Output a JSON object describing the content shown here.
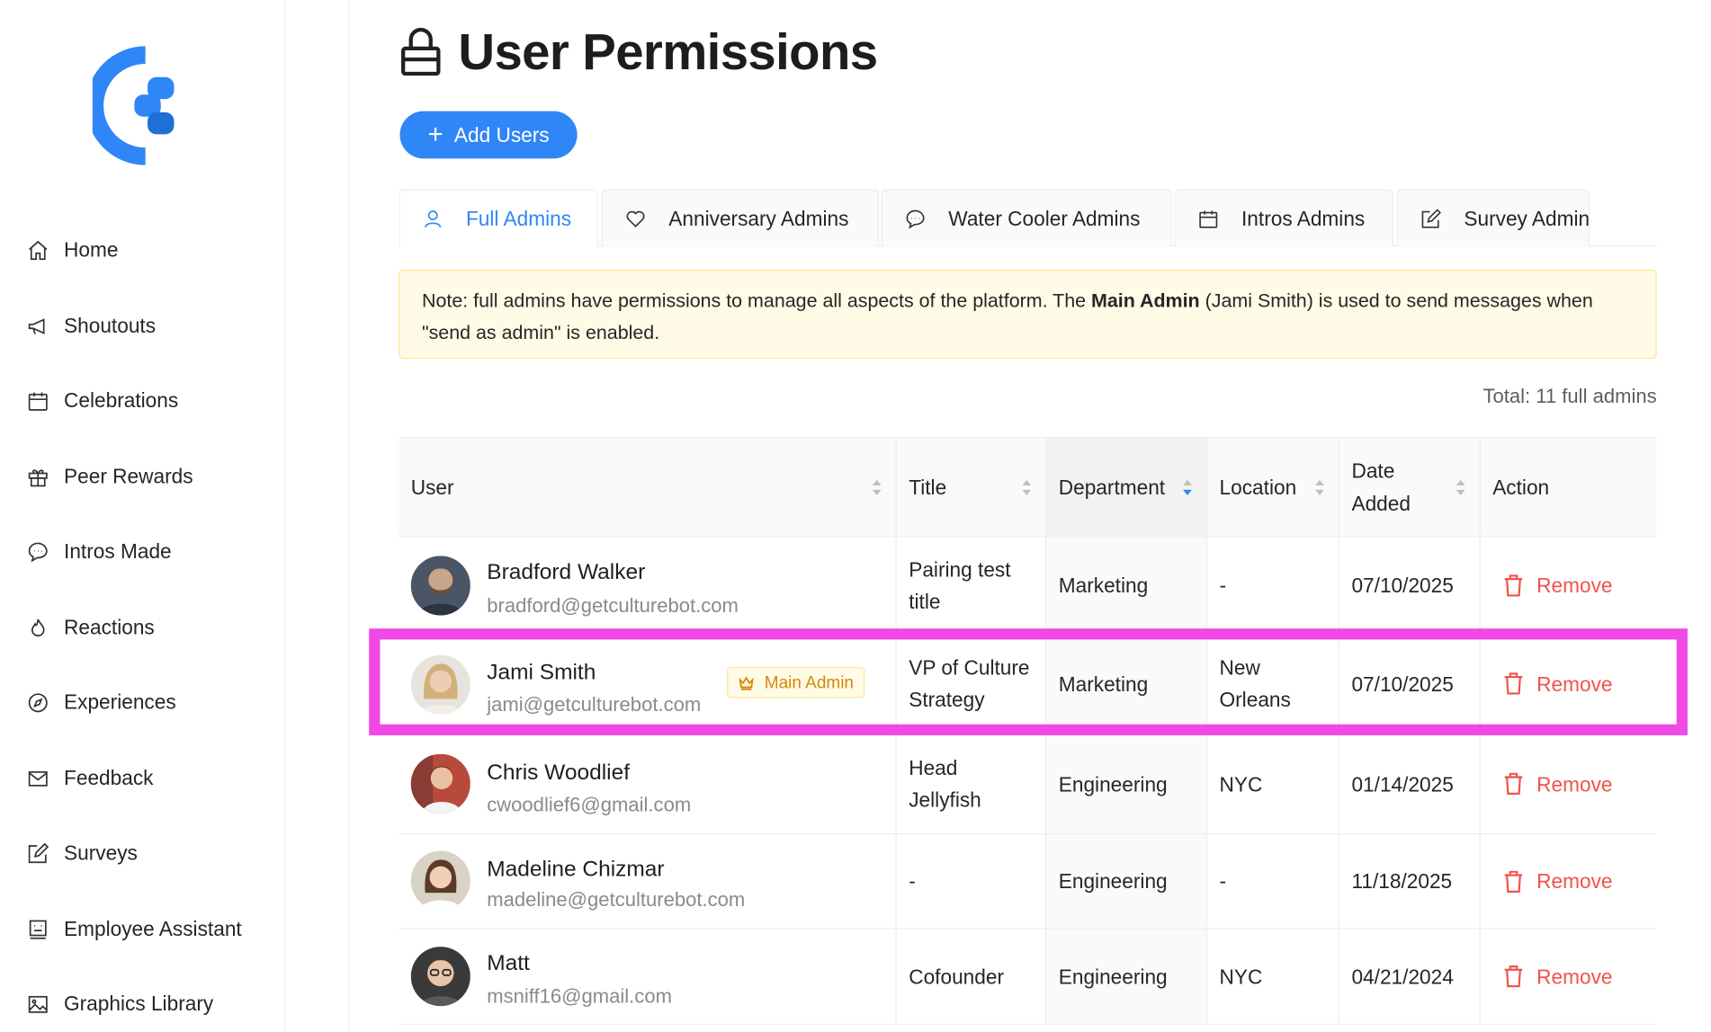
{
  "sidebar": {
    "items": [
      {
        "label": "Home",
        "icon": "home-icon"
      },
      {
        "label": "Shoutouts",
        "icon": "megaphone-icon"
      },
      {
        "label": "Celebrations",
        "icon": "calendar-icon"
      },
      {
        "label": "Peer Rewards",
        "icon": "gift-icon"
      },
      {
        "label": "Intros Made",
        "icon": "chat-icon"
      },
      {
        "label": "Reactions",
        "icon": "flame-icon"
      },
      {
        "label": "Experiences",
        "icon": "compass-icon"
      },
      {
        "label": "Feedback",
        "icon": "mail-icon"
      },
      {
        "label": "Surveys",
        "icon": "edit-icon"
      },
      {
        "label": "Employee Assistant",
        "icon": "robot-icon"
      },
      {
        "label": "Graphics Library",
        "icon": "image-icon"
      }
    ]
  },
  "header": {
    "title": "User Permissions",
    "add_button": "Add Users"
  },
  "tabs": [
    {
      "label": "Full Admins",
      "active": true
    },
    {
      "label": "Anniversary Admins"
    },
    {
      "label": "Water Cooler Admins"
    },
    {
      "label": "Intros Admins"
    },
    {
      "label": "Survey Admins"
    }
  ],
  "note": {
    "prefix": "Note: full admins have permissions to manage all aspects of the platform. The ",
    "bold": "Main Admin",
    "suffix": " (Jami Smith) is used to send messages when \"send as admin\" is enabled."
  },
  "total": "Total: 11 full admins",
  "table": {
    "headers": {
      "user": "User",
      "title": "Title",
      "department": "Department",
      "location": "Location",
      "date_added_1": "Date",
      "date_added_2": "Added",
      "action": "Action"
    },
    "rows": [
      {
        "name": "Bradford Walker",
        "email": "bradford@getculturebot.com",
        "title1": "Pairing test",
        "title2": "title",
        "department": "Marketing",
        "location1": "-",
        "location2": "",
        "date": "07/10/2025",
        "action": "Remove"
      },
      {
        "name": "Jami Smith",
        "email": "jami@getculturebot.com",
        "badge": "Main Admin",
        "title1": "VP of Culture",
        "title2": "Strategy",
        "department": "Marketing",
        "location1": "New",
        "location2": "Orleans",
        "date": "07/10/2025",
        "action": "Remove"
      },
      {
        "name": "Chris Woodlief",
        "email": "cwoodlief6@gmail.com",
        "title1": "Head",
        "title2": "Jellyfish",
        "department": "Engineering",
        "location1": "NYC",
        "location2": "",
        "date": "01/14/2025",
        "action": "Remove"
      },
      {
        "name": "Madeline Chizmar",
        "email": "madeline@getculturebot.com",
        "title1": "-",
        "title2": "",
        "department": "Engineering",
        "location1": "-",
        "location2": "",
        "date": "11/18/2025",
        "action": "Remove"
      },
      {
        "name": "Matt",
        "email": "msniff16@gmail.com",
        "title1": "Cofounder",
        "title2": "",
        "department": "Engineering",
        "location1": "NYC",
        "location2": "",
        "date": "04/21/2024",
        "action": "Remove"
      }
    ]
  },
  "colors": {
    "accent": "#2f86f6",
    "danger": "#f0534c",
    "highlight": "#f049e6",
    "note_bg": "#fffbe6"
  }
}
